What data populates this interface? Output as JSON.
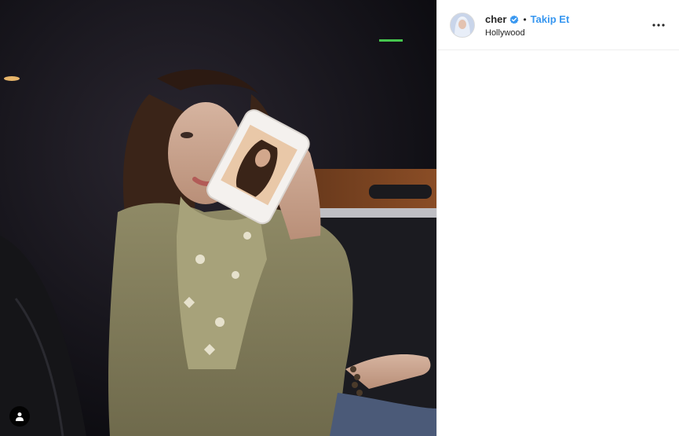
{
  "post": {
    "author": {
      "username": "cher",
      "verified": true,
      "separator": "•",
      "follow_label": "Takip Et",
      "location": "Hollywood"
    },
    "media": {
      "description_icon": "user-tag-icon"
    },
    "icons": {
      "verified": "verified-badge-icon",
      "more": "more-options-icon",
      "tag": "user-tag-icon"
    },
    "colors": {
      "link_blue": "#3897f0",
      "text": "#262626",
      "border": "#efefef"
    }
  }
}
